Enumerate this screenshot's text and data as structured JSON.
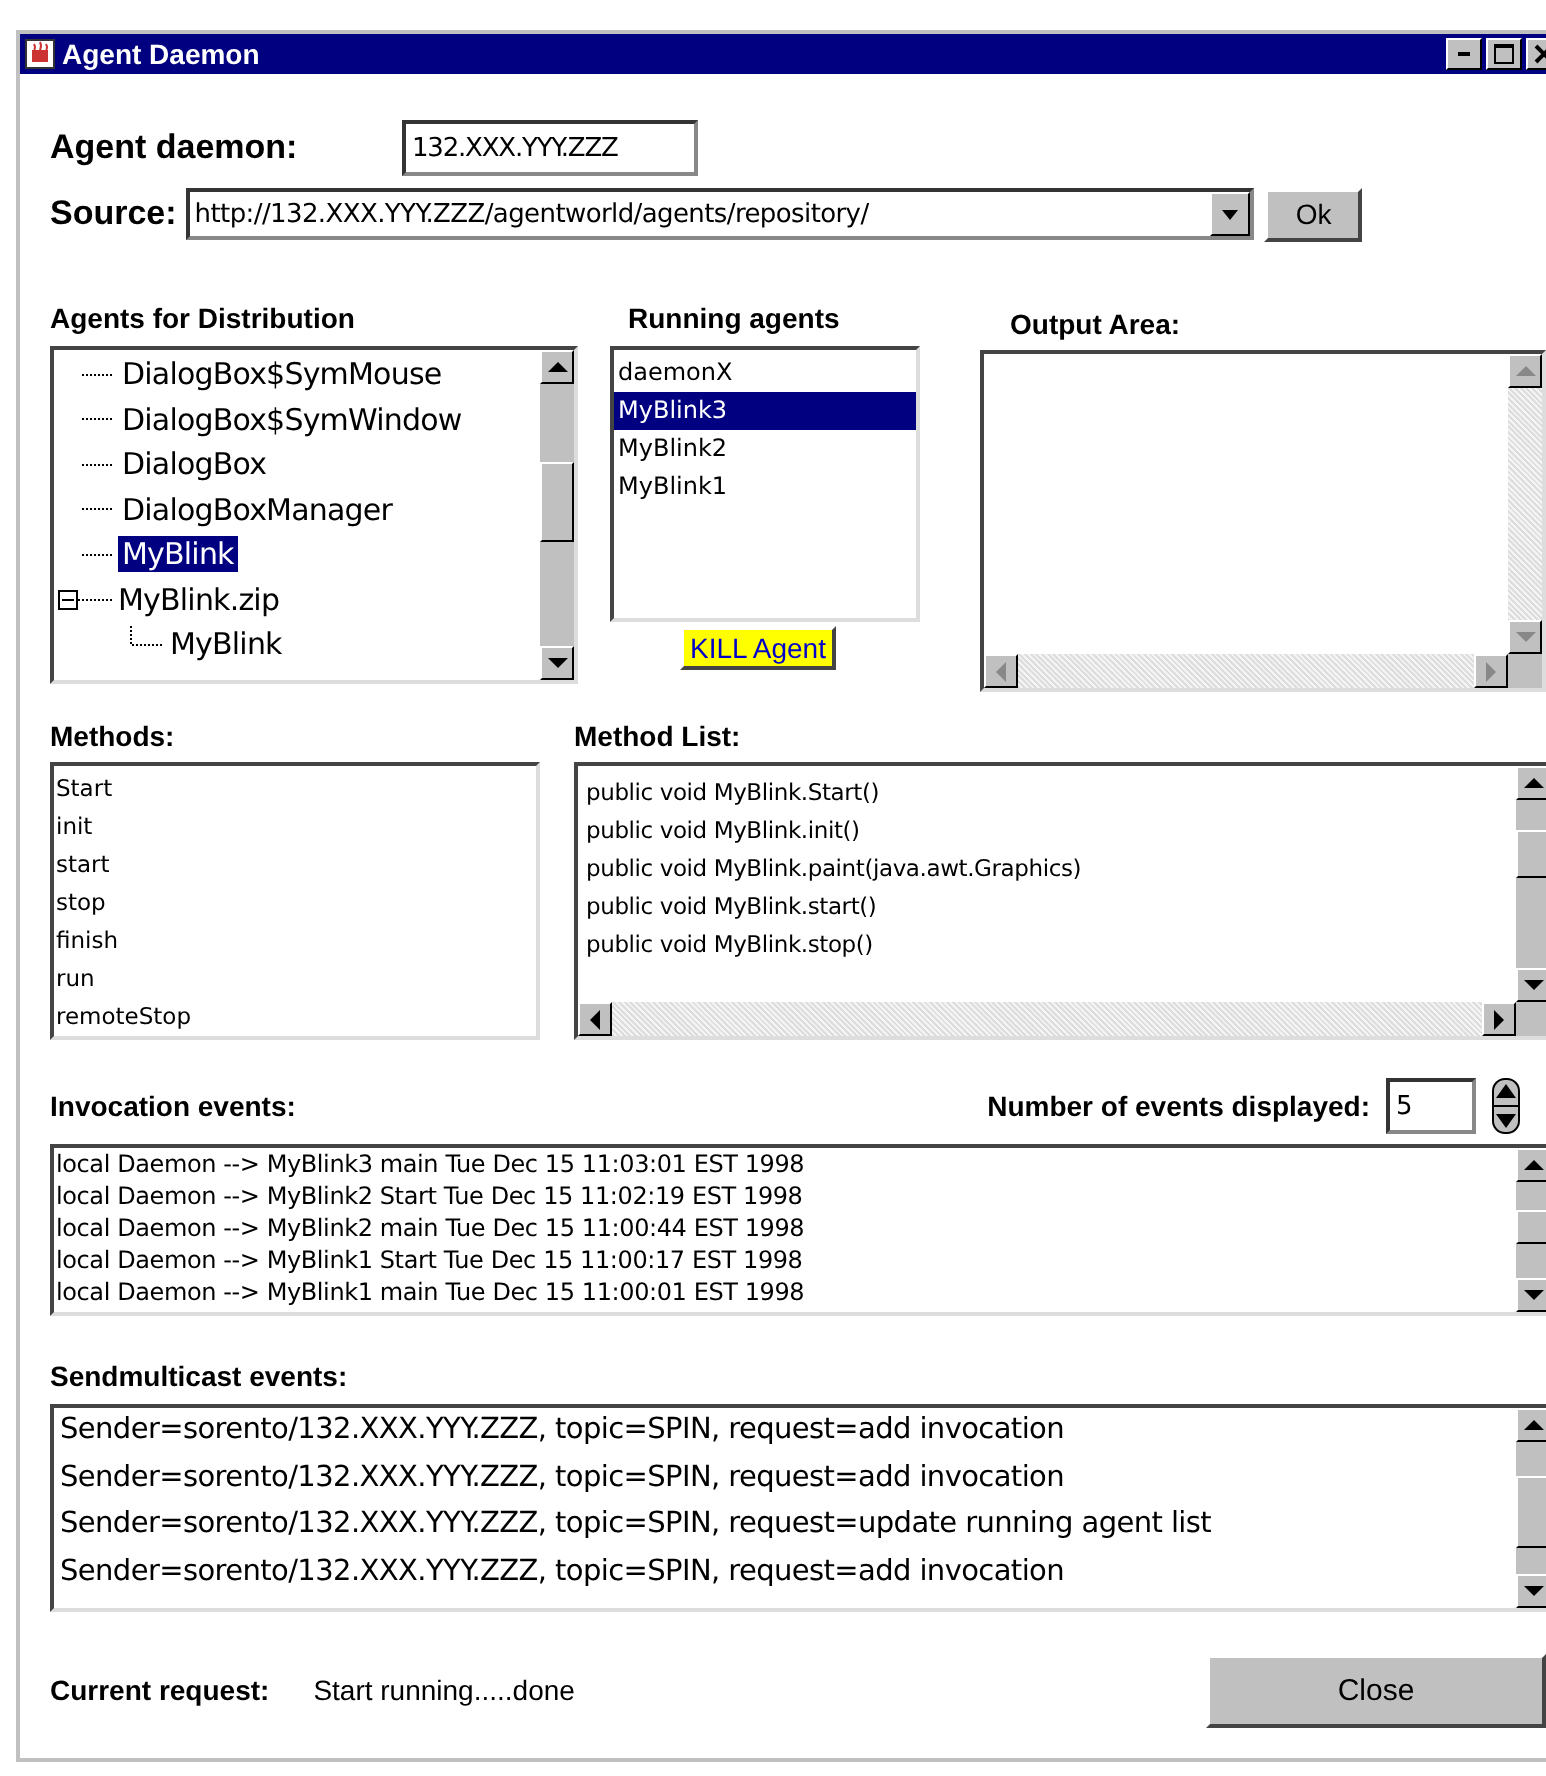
{
  "window": {
    "title": "Agent Daemon"
  },
  "agent_daemon": {
    "label": "Agent daemon:",
    "value": "132.XXX.YYY.ZZZ"
  },
  "source": {
    "label": "Source:",
    "value": "http://132.XXX.YYY.ZZZ/agentworld/agents/repository/",
    "button": "Ok"
  },
  "agents_for_distribution": {
    "label": "Agents for Distribution",
    "items": [
      {
        "label": "DialogBox$SymMouse",
        "selected": false
      },
      {
        "label": "DialogBox$SymWindow",
        "selected": false
      },
      {
        "label": "DialogBox",
        "selected": false
      },
      {
        "label": "DialogBoxManager",
        "selected": false
      },
      {
        "label": "MyBlink",
        "selected": true
      },
      {
        "label": "MyBlink.zip",
        "selected": false,
        "expanded": true,
        "children": [
          {
            "label": "MyBlink",
            "selected": false
          }
        ]
      }
    ]
  },
  "running_agents": {
    "label": "Running agents",
    "items": [
      {
        "label": "daemonX",
        "selected": false
      },
      {
        "label": "MyBlink3",
        "selected": true
      },
      {
        "label": "MyBlink2",
        "selected": false
      },
      {
        "label": "MyBlink1",
        "selected": false
      }
    ],
    "button": "KILL Agent"
  },
  "output_area": {
    "label": "Output Area:"
  },
  "methods": {
    "label": "Methods:",
    "items": [
      "Start",
      "init",
      "start",
      "stop",
      "finish",
      "run",
      "remoteStop"
    ]
  },
  "method_list": {
    "label": "Method List:",
    "items": [
      "public void MyBlink.Start()",
      "public void MyBlink.init()",
      "public void MyBlink.paint(java.awt.Graphics)",
      "public void MyBlink.start()",
      "public void MyBlink.stop()"
    ]
  },
  "invocation_events": {
    "label": "Invocation events:",
    "count_label": "Number of events displayed:",
    "count": "5",
    "items": [
      "local Daemon  -->  MyBlink3 main Tue Dec 15 11:03:01 EST 1998",
      "local Daemon  -->  MyBlink2 Start Tue Dec 15 11:02:19 EST 1998",
      "local Daemon  -->  MyBlink2 main Tue Dec 15 11:00:44 EST 1998",
      "local Daemon  -->  MyBlink1 Start Tue Dec 15 11:00:17 EST 1998",
      "local Daemon  -->  MyBlink1 main Tue Dec 15 11:00:01 EST 1998"
    ]
  },
  "sendmulticast_events": {
    "label": "Sendmulticast events:",
    "items": [
      "Sender=sorento/132.XXX.YYY.ZZZ, topic=SPIN, request=add invocation",
      "Sender=sorento/132.XXX.YYY.ZZZ, topic=SPIN, request=add invocation",
      "Sender=sorento/132.XXX.YYY.ZZZ, topic=SPIN, request=update running agent list",
      "Sender=sorento/132.XXX.YYY.ZZZ, topic=SPIN, request=add invocation"
    ]
  },
  "current_request": {
    "label": "Current request:",
    "value": "Start running.....done"
  },
  "close_button": "Close"
}
